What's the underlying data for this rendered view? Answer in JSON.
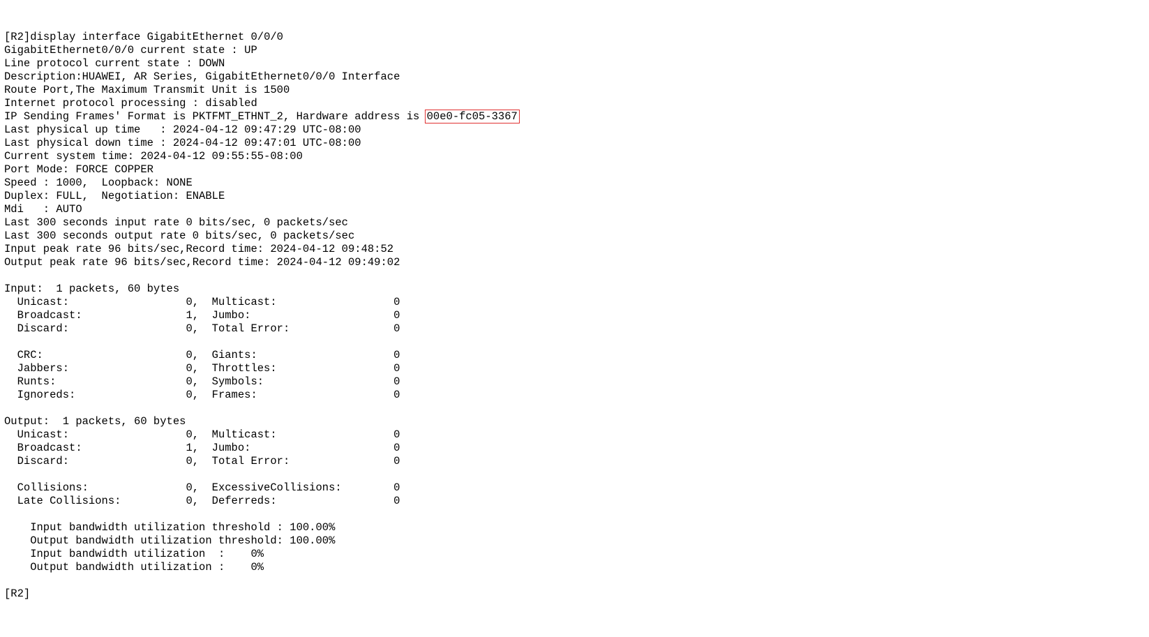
{
  "prompt1": "[R2]",
  "cmd": "display interface GigabitEthernet 0/0/0",
  "l2": "GigabitEthernet0/0/0 current state : UP",
  "l3": "Line protocol current state : DOWN",
  "l4": "Description:HUAWEI, AR Series, GigabitEthernet0/0/0 Interface",
  "l5": "Route Port,The Maximum Transmit Unit is 1500",
  "l6": "Internet protocol processing : disabled",
  "l7a": "IP Sending Frames' Format is PKTFMT_ETHNT_2, Hardware address is ",
  "mac": "00e0-fc05-3367",
  "l8": "Last physical up time   : 2024-04-12 09:47:29 UTC-08:00",
  "l9": "Last physical down time : 2024-04-12 09:47:01 UTC-08:00",
  "l10": "Current system time: 2024-04-12 09:55:55-08:00",
  "l11": "Port Mode: FORCE COPPER",
  "l12": "Speed : 1000,  Loopback: NONE",
  "l13": "Duplex: FULL,  Negotiation: ENABLE",
  "l14": "Mdi   : AUTO",
  "l15": "Last 300 seconds input rate 0 bits/sec, 0 packets/sec",
  "l16": "Last 300 seconds output rate 0 bits/sec, 0 packets/sec",
  "l17": "Input peak rate 96 bits/sec,Record time: 2024-04-12 09:48:52",
  "l18": "Output peak rate 96 bits/sec,Record time: 2024-04-12 09:49:02",
  "in_hdr": "Input:  1 packets, 60 bytes",
  "in1": "  Unicast:                  0,  Multicast:                  0",
  "in2": "  Broadcast:                1,  Jumbo:                      0",
  "in3": "  Discard:                  0,  Total Error:                0",
  "in4": "  CRC:                      0,  Giants:                     0",
  "in5": "  Jabbers:                  0,  Throttles:                  0",
  "in6": "  Runts:                    0,  Symbols:                    0",
  "in7": "  Ignoreds:                 0,  Frames:                     0",
  "out_hdr": "Output:  1 packets, 60 bytes",
  "out1": "  Unicast:                  0,  Multicast:                  0",
  "out2": "  Broadcast:                1,  Jumbo:                      0",
  "out3": "  Discard:                  0,  Total Error:                0",
  "out4": "  Collisions:               0,  ExcessiveCollisions:        0",
  "out5": "  Late Collisions:          0,  Deferreds:                  0",
  "bw1": "    Input bandwidth utilization threshold : 100.00%",
  "bw2": "    Output bandwidth utilization threshold: 100.00%",
  "bw3": "    Input bandwidth utilization  :    0%",
  "bw4": "    Output bandwidth utilization :    0%",
  "prompt2": "[R2]"
}
